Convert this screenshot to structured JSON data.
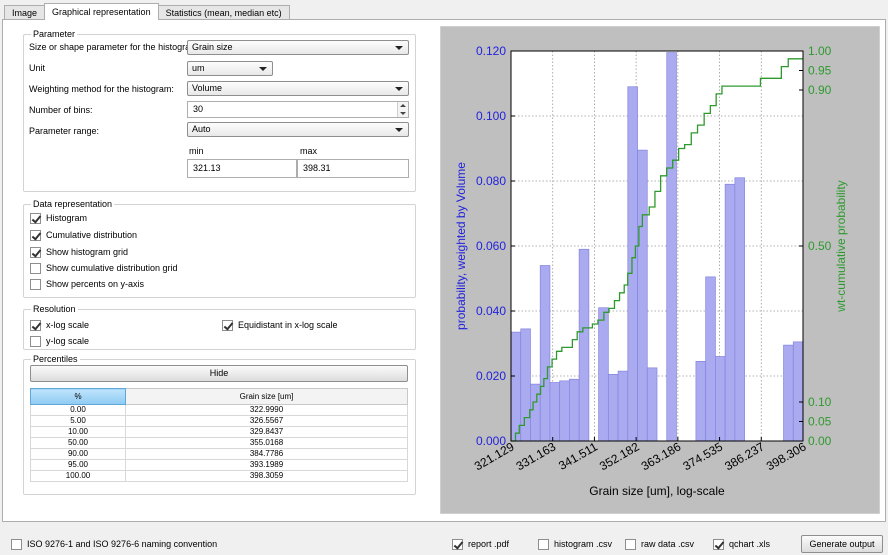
{
  "tabs": [
    {
      "label": "Image"
    },
    {
      "label": "Graphical representation"
    },
    {
      "label": "Statistics (mean, median etc)"
    }
  ],
  "parameter": {
    "title": "Parameter",
    "size_label": "Size or shape parameter for the histogram:",
    "size_value": "Grain size",
    "unit_label": "Unit",
    "unit_value": "um",
    "weight_label": "Weighting method for the histogram:",
    "weight_value": "Volume",
    "bins_label": "Number of bins:",
    "bins_value": "30",
    "range_label": "Parameter range:",
    "range_value": "Auto",
    "min_label": "min",
    "min_value": "321.13",
    "max_label": "max",
    "max_value": "398.31"
  },
  "data_representation": {
    "title": "Data representation",
    "items": [
      {
        "label": "Histogram",
        "checked": true
      },
      {
        "label": "Cumulative distribution",
        "checked": true
      },
      {
        "label": "Show histogram grid",
        "checked": true
      },
      {
        "label": "Show cumulative distribution grid",
        "checked": false
      },
      {
        "label": "Show percents on y-axis",
        "checked": false
      }
    ]
  },
  "resolution": {
    "title": "Resolution",
    "xlog_label": "x-log scale",
    "xlog_checked": true,
    "ylog_label": "y-log scale",
    "ylog_checked": false,
    "equi_label": "Equidistant in x-log scale",
    "equi_checked": true
  },
  "percentiles": {
    "title": "Percentiles",
    "hide_label": "Hide",
    "headers": [
      "%",
      "Grain size [um]"
    ],
    "rows": [
      [
        "0.00",
        "322.9990"
      ],
      [
        "5.00",
        "326.5567"
      ],
      [
        "10.00",
        "329.8437"
      ],
      [
        "50.00",
        "355.0168"
      ],
      [
        "90.00",
        "384.7786"
      ],
      [
        "95.00",
        "393.1989"
      ],
      [
        "100.00",
        "398.3059"
      ]
    ]
  },
  "bottom": {
    "iso_label": "ISO 9276-1 and ISO 9276-6 naming convention",
    "iso_checked": false,
    "report_label": "report .pdf",
    "report_checked": true,
    "hist_label": "histogram .csv",
    "hist_checked": false,
    "raw_label": "raw data .csv",
    "raw_checked": false,
    "qchart_label": "qchart .xls",
    "qchart_checked": true,
    "generate_label": "Generate output"
  },
  "colors": {
    "bar_fill": "#aaaaf0",
    "bar_edge": "#8484dd",
    "left_axis": "#2222dd",
    "right_axis": "#2e9a2e",
    "plot_bg": "#ffffff",
    "figure_bg": "#bfbfbf"
  },
  "chart_data": {
    "type": "bar",
    "xlabel": "Grain size [um], log-scale",
    "ylabel": "probability, weighted by Volume",
    "y2label": "wt-cumulative probability",
    "x_scale": "log",
    "xlim": [
      321.13,
      398.31
    ],
    "ylim": [
      0,
      0.12
    ],
    "y2lim": [
      0,
      1.0
    ],
    "grid": true,
    "x_ticks": [
      "321.129",
      "331.163",
      "341.511",
      "352.182",
      "363.186",
      "374.535",
      "386.237",
      "398.306"
    ],
    "y_ticks": [
      "0.000",
      "0.020",
      "0.040",
      "0.060",
      "0.080",
      "0.100",
      "0.120"
    ],
    "y2_ticks": [
      "0.00",
      "0.05",
      "0.10",
      "0.50",
      "0.90",
      "0.95",
      "1.00"
    ],
    "histogram": [
      0.0335,
      0.0345,
      0.0175,
      0.054,
      0.018,
      0.0185,
      0.019,
      0.059,
      0.0,
      0.041,
      0.0205,
      0.0215,
      0.109,
      0.0895,
      0.0225,
      0.0,
      0.1195,
      0.0,
      0.0,
      0.0245,
      0.0505,
      0.026,
      0.079,
      0.081,
      0.0,
      0.0,
      0.0,
      0.0,
      0.0295,
      0.0305
    ],
    "cumulative": {
      "x": [
        321.13,
        322.2,
        323.1,
        324.3,
        325.6,
        326.4,
        327.3,
        328.2,
        329.0,
        329.9,
        331.0,
        332.1,
        333.4,
        334.6,
        336.0,
        337.2,
        338.6,
        339.8,
        341.0,
        342.4,
        343.9,
        345.2,
        346.6,
        347.9,
        349.1,
        350.0,
        351.1,
        352.0,
        352.9,
        353.8,
        354.7,
        355.6,
        357.1,
        358.6,
        360.2,
        361.8,
        363.4,
        365.0,
        366.8,
        368.5,
        370.3,
        372.0,
        373.6,
        375.2,
        376.8,
        378.4,
        380.0,
        382.0,
        384.0,
        386.0,
        388.0,
        390.0,
        392.0,
        394.0,
        396.0,
        398.31
      ],
      "y": [
        0.0,
        0.02,
        0.04,
        0.06,
        0.08,
        0.1,
        0.12,
        0.14,
        0.16,
        0.19,
        0.21,
        0.23,
        0.24,
        0.24,
        0.26,
        0.28,
        0.29,
        0.29,
        0.3,
        0.31,
        0.33,
        0.34,
        0.36,
        0.38,
        0.4,
        0.43,
        0.47,
        0.5,
        0.55,
        0.58,
        0.58,
        0.6,
        0.64,
        0.68,
        0.7,
        0.72,
        0.75,
        0.76,
        0.79,
        0.81,
        0.84,
        0.86,
        0.89,
        0.91,
        0.91,
        0.91,
        0.91,
        0.91,
        0.91,
        0.93,
        0.93,
        0.93,
        0.96,
        0.98,
        0.98,
        0.98
      ]
    }
  }
}
